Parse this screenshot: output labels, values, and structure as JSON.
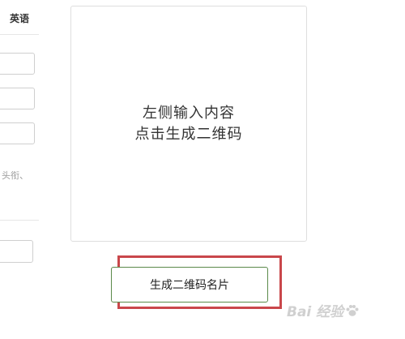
{
  "lang_tab": {
    "label": "英语"
  },
  "form": {
    "hint_fragment": "头衔、"
  },
  "preview": {
    "line1": "左侧输入内容",
    "line2": "点击生成二维码"
  },
  "actions": {
    "generate_label": "生成二维码名片"
  },
  "colors": {
    "highlight": "#c9474b",
    "button_border": "#5b8a4a"
  },
  "watermark": {
    "text": "Bai 经验",
    "icon": "paw-icon"
  }
}
